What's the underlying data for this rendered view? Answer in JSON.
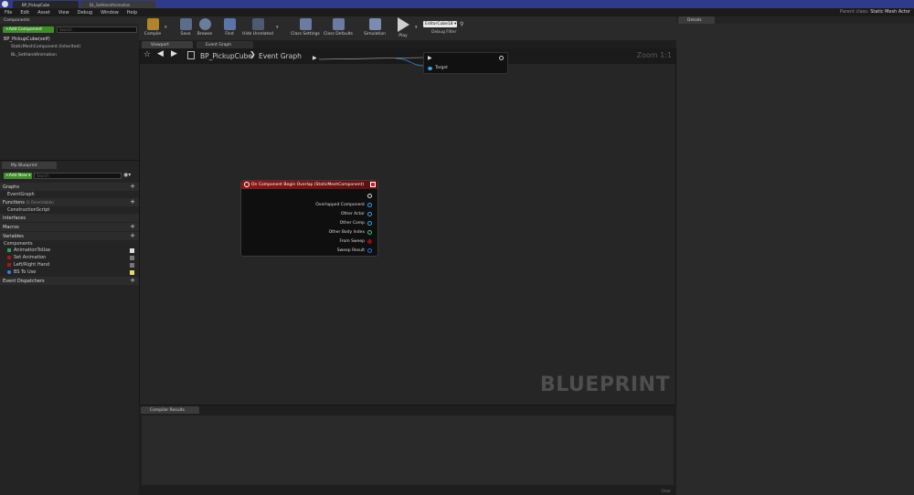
{
  "window": {
    "tabs": [
      {
        "label": "BP_PickupCube"
      },
      {
        "label": "BL_SetHandAnimation"
      }
    ]
  },
  "menu": [
    "File",
    "Edit",
    "Asset",
    "View",
    "Debug",
    "Window",
    "Help"
  ],
  "parent_class": {
    "label": "Parent class:",
    "value": "Static Mesh Actor"
  },
  "components": {
    "header": "Components",
    "add_button": "+Add Component",
    "search_placeholder": "Search",
    "items": [
      "BP_PickupCube(self)",
      "StaticMeshComponent (Inherited)",
      "BL_SetHandAnimation"
    ]
  },
  "toolbar": {
    "buttons": [
      {
        "label": "Compile",
        "icon": "compile-icon"
      },
      {
        "label": "Save",
        "icon": "save-icon"
      },
      {
        "label": "Browse",
        "icon": "browse-icon"
      },
      {
        "label": "Find",
        "icon": "find-icon"
      },
      {
        "label": "Hide Unrelated",
        "icon": "hide-unrelated-icon"
      },
      {
        "label": "Class Settings",
        "icon": "class-settings-icon"
      },
      {
        "label": "Class Defaults",
        "icon": "class-defaults-icon"
      },
      {
        "label": "Simulation",
        "icon": "simulation-icon"
      },
      {
        "label": "Play",
        "icon": "play-icon"
      }
    ],
    "debug_object": "EditorCube18",
    "debug_filter": "Debug Filter"
  },
  "editor_tabs": [
    "Viewport",
    "Event Graph"
  ],
  "breadcrumb": {
    "root": "BP_PickupCube",
    "current": "Event Graph",
    "zoom": "Zoom 1:1"
  },
  "watermark": "BLUEPRINT",
  "target_node": {
    "pin": "Target"
  },
  "event_node": {
    "title": "On Component Begin Overlap (StaticMeshComponent)",
    "pins": [
      {
        "label": "Overlapped Component",
        "color": "#3ba3e6"
      },
      {
        "label": "Other Actor",
        "color": "#3ba3e6"
      },
      {
        "label": "Other Comp",
        "color": "#3ba3e6"
      },
      {
        "label": "Other Body Index",
        "color": "#3fc48a"
      },
      {
        "label": "From Sweep",
        "color": "#8b1010"
      },
      {
        "label": "Sweep Result",
        "color": "#2e6fd0"
      }
    ]
  },
  "my_blueprint": {
    "tab": "My Blueprint",
    "add_new": "+Add New",
    "search_placeholder": "Search",
    "sections": {
      "graphs": "Graphs",
      "event_graph": "EventGraph",
      "functions": "Functions",
      "functions_note": "(1 Overridable)",
      "construction": "ConstructionScript",
      "interfaces": "Interfaces",
      "macros": "Macros",
      "variables": "Variables",
      "components": "Components",
      "dispatchers": "Event Dispatchers"
    },
    "variables": [
      {
        "label": "AnimationToUse",
        "color": "#2ca05a"
      },
      {
        "label": "Set Animation",
        "color": "#a01818"
      },
      {
        "label": "Left/Right Hand",
        "color": "#a01818"
      },
      {
        "label": "BS To Use",
        "color": "#3b7fe0"
      }
    ]
  },
  "compiler": {
    "tab": "Compiler Results",
    "footer": "Clear"
  },
  "details": {
    "tab": "Details"
  }
}
